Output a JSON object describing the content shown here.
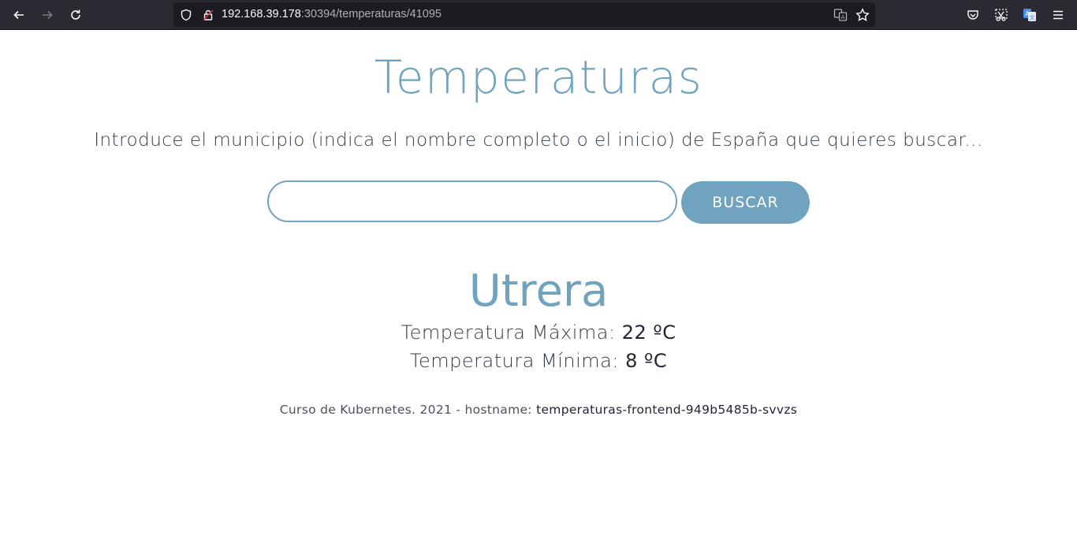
{
  "browser": {
    "url_host": "192.168.39.178",
    "url_rest": ":30394/temperaturas/41095",
    "icons": [
      "back-icon",
      "forward-icon",
      "reload-icon",
      "shield-icon",
      "lock-icon",
      "translate-icon",
      "bookmark-star-icon",
      "pocket-icon",
      "screenshot-icon",
      "translate-extension-icon",
      "menu-icon"
    ]
  },
  "page": {
    "title": "Temperaturas",
    "instructions": "Introduce el municipio (indica el nombre completo o el inicio) de España que quieres buscar...",
    "search": {
      "value": "",
      "placeholder": ""
    },
    "button_label": "BUSCAR"
  },
  "result": {
    "city": "Utrera",
    "max_label": "Temperatura Máxima:",
    "max_value": "22 ºC",
    "min_label": "Temperatura Mínima:",
    "min_value": "8 ºC"
  },
  "footer": {
    "text": "Curso de Kubernetes. 2021 - hostname:",
    "hostname": "temperaturas-frontend-949b5485b-svvzs"
  },
  "colors": {
    "accent": "#6fa3bf",
    "text": "#333b4a",
    "toolbar_bg": "#2b2a33",
    "urlbar_bg": "#1c1b22"
  }
}
